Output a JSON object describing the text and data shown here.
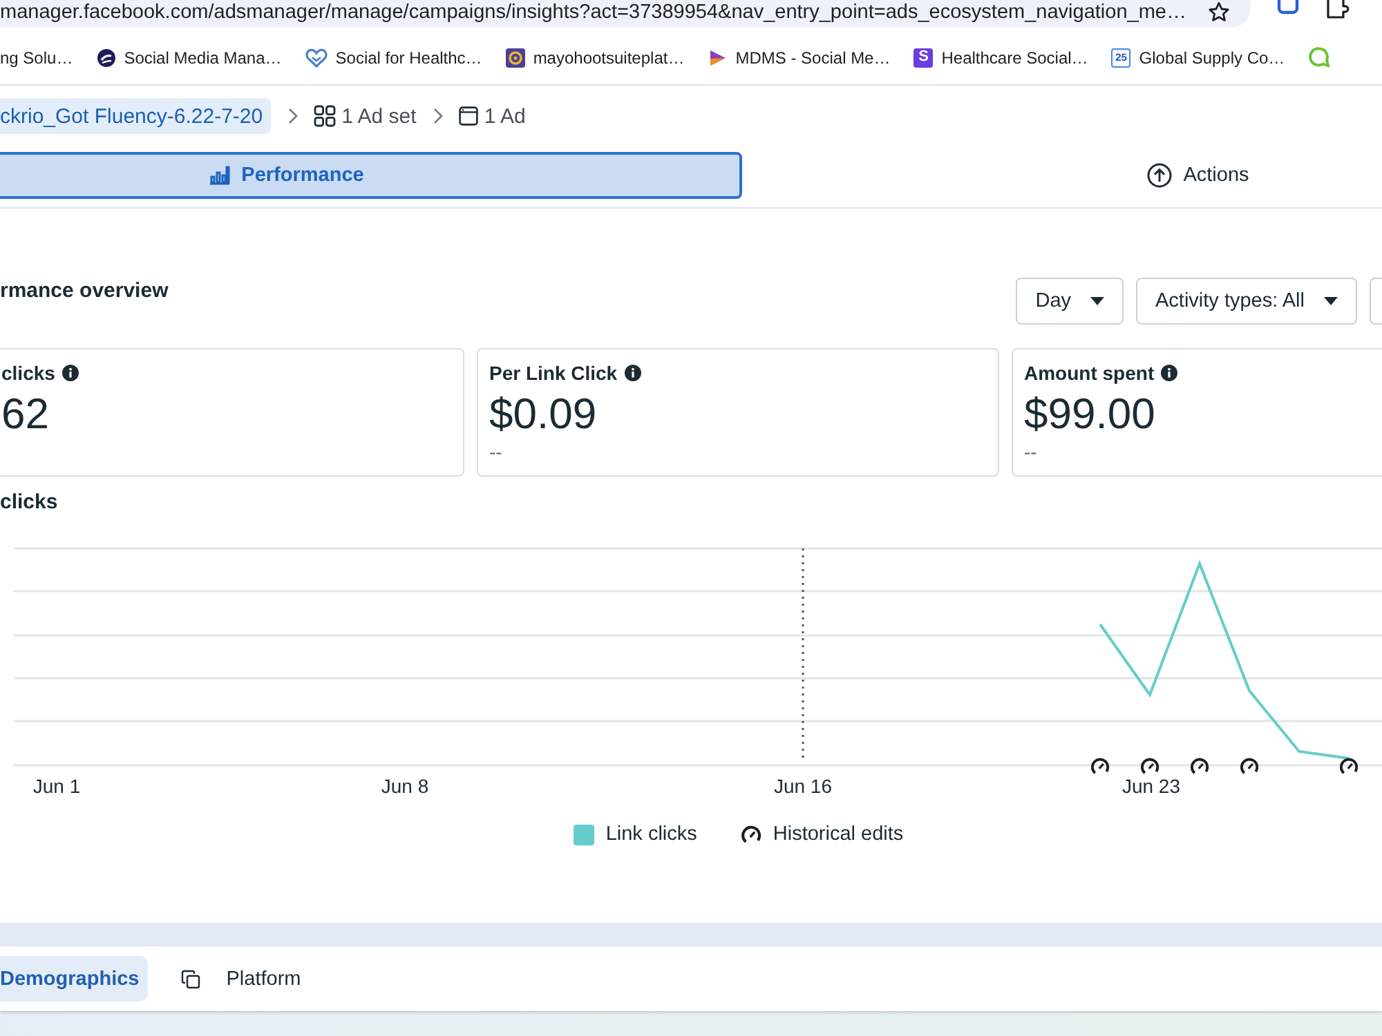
{
  "browser": {
    "url": "manager.facebook.com/adsmanager/manage/campaigns/insights?act=37389954&nav_entry_point=ads_ecosystem_navigation_me…",
    "bookmarks": [
      {
        "label": "ng Solu…"
      },
      {
        "label": "Social Media Mana…"
      },
      {
        "label": "Social for Healthc…"
      },
      {
        "label": "mayohootsuiteplat…"
      },
      {
        "label": "MDMS - Social Me…"
      },
      {
        "label": "Healthcare Social…",
        "icon_text": "S"
      },
      {
        "label": "Global Supply Co…",
        "icon_text": "25"
      }
    ]
  },
  "breadcrumbs": [
    {
      "label": "ckrio_Got Fluency-6.22-7-20",
      "selected": true
    },
    {
      "label": "1 Ad set",
      "selected": false
    },
    {
      "label": "1 Ad",
      "selected": false
    }
  ],
  "tabs": [
    {
      "label": "Performance",
      "selected": true
    },
    {
      "label": "Actions",
      "selected": false
    }
  ],
  "overview": {
    "title": "rmance overview",
    "controls": [
      {
        "label": "Day"
      },
      {
        "label": "Activity types: All"
      }
    ]
  },
  "metrics": [
    {
      "label": "clicks",
      "value": "62"
    },
    {
      "label": "Per Link Click",
      "value": "$0.09",
      "comparison": "--"
    },
    {
      "label": "Amount spent",
      "value": "$99.00",
      "comparison": "--"
    }
  ],
  "chart": {
    "title": "clicks",
    "x_labels": [
      "Jun 1",
      "Jun 8",
      "Jun 16",
      "Jun 23"
    ],
    "legend": [
      {
        "kind": "swatch",
        "label": "Link clicks",
        "color": "#66cccc"
      },
      {
        "kind": "edit",
        "label": "Historical edits"
      }
    ]
  },
  "breakdown_tabs": [
    {
      "label": "Demographics",
      "selected": true
    },
    {
      "label": "Platform",
      "selected": false
    }
  ]
}
